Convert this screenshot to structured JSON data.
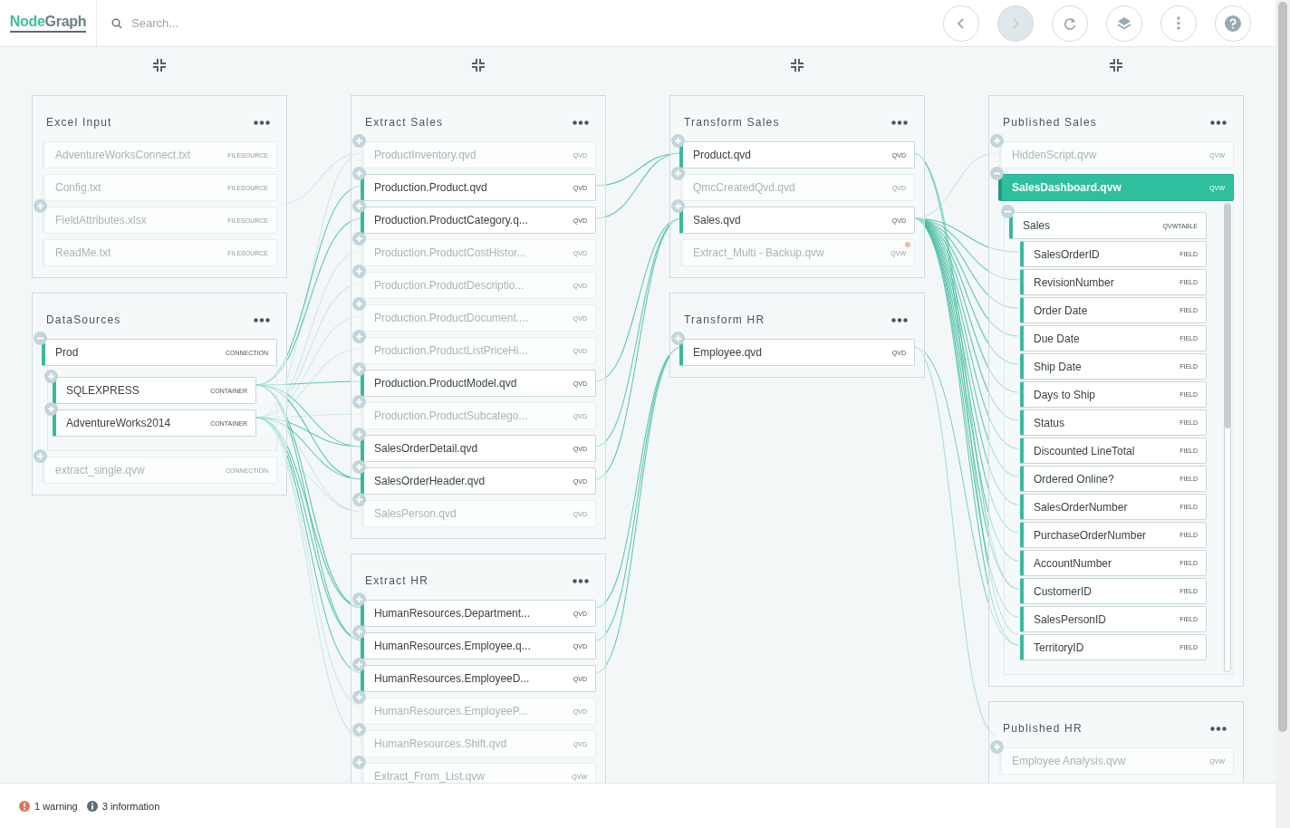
{
  "header": {
    "logo": [
      "Node",
      "Graph"
    ],
    "search": {
      "placeholder": "Search..."
    },
    "toolbar": [
      {
        "kind": "back",
        "disabled": false
      },
      {
        "kind": "forward",
        "disabled": true
      },
      {
        "kind": "refresh",
        "disabled": false
      },
      {
        "kind": "layers",
        "disabled": false
      },
      {
        "kind": "more",
        "disabled": false
      },
      {
        "kind": "help",
        "disabled": false
      }
    ]
  },
  "columns": [
    {
      "groups": [
        {
          "title": "Excel Input",
          "items": [
            {
              "label": "AdventureWorksConnect.txt",
              "type": "FILESOURCE",
              "active": false,
              "selected": false
            },
            {
              "label": "Config.txt",
              "type": "FILESOURCE",
              "active": false,
              "selected": false
            },
            {
              "label": "FieldAttributes.xlsx",
              "type": "FILESOURCE",
              "active": false,
              "selected": false,
              "expanded": false
            },
            {
              "label": "ReadMe.txt",
              "type": "FILESOURCE",
              "active": false,
              "selected": false
            }
          ]
        },
        {
          "title": "DataSources",
          "items": [
            {
              "label": "Prod",
              "type": "CONNECTION",
              "active": true,
              "selected": false,
              "expanded": true,
              "children": [
                {
                  "label": "SQLEXPRESS",
                  "type": "CONTAINER",
                  "active": true,
                  "selected": false,
                  "expanded": false
                },
                {
                  "label": "AdventureWorks2014",
                  "type": "CONTAINER",
                  "active": true,
                  "selected": false,
                  "expanded": false
                }
              ]
            },
            {
              "label": "extract_single.qvw",
              "type": "CONNECTION",
              "active": false,
              "selected": false,
              "expanded": false
            }
          ]
        }
      ]
    },
    {
      "groups": [
        {
          "title": "Extract Sales",
          "items": [
            {
              "label": "ProductInventory.qvd",
              "type": "QVD",
              "active": false,
              "selected": false,
              "expanded": false
            },
            {
              "label": "Production.Product.qvd",
              "type": "QVD",
              "active": true,
              "selected": false,
              "expanded": false
            },
            {
              "label": "Production.ProductCategory.q...",
              "type": "QVD",
              "active": true,
              "selected": false,
              "expanded": false
            },
            {
              "label": "Production.ProductCostHistor...",
              "type": "QVD",
              "active": false,
              "selected": false,
              "expanded": false
            },
            {
              "label": "Production.ProductDescriptio...",
              "type": "QVD",
              "active": false,
              "selected": false,
              "expanded": false
            },
            {
              "label": "Production.ProductDocument....",
              "type": "QVD",
              "active": false,
              "selected": false,
              "expanded": false
            },
            {
              "label": "Production.ProductListPriceHi...",
              "type": "QVD",
              "active": false,
              "selected": false,
              "expanded": false
            },
            {
              "label": "Production.ProductModel.qvd",
              "type": "QVD",
              "active": true,
              "selected": false,
              "expanded": false
            },
            {
              "label": "Production.ProductSubcatego...",
              "type": "QVD",
              "active": false,
              "selected": false,
              "expanded": false
            },
            {
              "label": "SalesOrderDetail.qvd",
              "type": "QVD",
              "active": true,
              "selected": false,
              "expanded": false
            },
            {
              "label": "SalesOrderHeader.qvd",
              "type": "QVD",
              "active": true,
              "selected": false,
              "expanded": false
            },
            {
              "label": "SalesPerson.qvd",
              "type": "QVD",
              "active": false,
              "selected": false,
              "expanded": false
            }
          ]
        },
        {
          "title": "Extract HR",
          "items": [
            {
              "label": "HumanResources.Department...",
              "type": "QVD",
              "active": true,
              "selected": false,
              "expanded": false
            },
            {
              "label": "HumanResources.Employee.q...",
              "type": "QVD",
              "active": true,
              "selected": false,
              "expanded": false
            },
            {
              "label": "HumanResources.EmployeeD...",
              "type": "QVD",
              "active": true,
              "selected": false,
              "expanded": false
            },
            {
              "label": "HumanResources.EmployeeP...",
              "type": "QVD",
              "active": false,
              "selected": false,
              "expanded": false
            },
            {
              "label": "HumanResources.Shift.qvd",
              "type": "QVD",
              "active": false,
              "selected": false,
              "expanded": false
            },
            {
              "label": "Extract_From_List.qvw",
              "type": "QVW",
              "active": false,
              "selected": false,
              "expanded": false
            }
          ]
        }
      ]
    },
    {
      "groups": [
        {
          "title": "Transform Sales",
          "items": [
            {
              "label": "Product.qvd",
              "type": "QVD",
              "active": true,
              "selected": false,
              "warning": false,
              "expanded": false
            },
            {
              "label": "QmcCreatedQvd.qvd",
              "type": "QVD",
              "active": false,
              "selected": false,
              "warning": false,
              "expanded": false
            },
            {
              "label": "Sales.qvd",
              "type": "QVD",
              "active": true,
              "selected": false,
              "warning": false,
              "expanded": false
            },
            {
              "label": "Extract_Multi - Backup.qvw",
              "type": "QVW",
              "active": false,
              "selected": false,
              "warning": true
            }
          ]
        },
        {
          "title": "Transform HR",
          "items": [
            {
              "label": "Employee.qvd",
              "type": "QVD",
              "active": true,
              "selected": false,
              "expanded": false
            }
          ]
        }
      ]
    },
    {
      "groups": [
        {
          "title": "Published Sales",
          "items": [
            {
              "label": "HiddenScript.qvw",
              "type": "QVW",
              "active": false,
              "selected": false,
              "expanded": false
            },
            {
              "label": "SalesDashboard.qvw",
              "type": "QVW",
              "active": true,
              "selected": true,
              "expanded": true,
              "children": [
                {
                  "label": "Sales",
                  "type": "QVWTABLE",
                  "active": true,
                  "selected": false,
                  "expanded": true,
                  "children": [
                    {
                      "label": "SalesOrderID",
                      "type": "FIELD",
                      "active": true,
                      "selected": false
                    },
                    {
                      "label": "RevisionNumber",
                      "type": "FIELD",
                      "active": true,
                      "selected": false
                    },
                    {
                      "label": "Order Date",
                      "type": "FIELD",
                      "active": true,
                      "selected": false
                    },
                    {
                      "label": "Due Date",
                      "type": "FIELD",
                      "active": true,
                      "selected": false
                    },
                    {
                      "label": "Ship Date",
                      "type": "FIELD",
                      "active": true,
                      "selected": false
                    },
                    {
                      "label": "Days to Ship",
                      "type": "FIELD",
                      "active": true,
                      "selected": false
                    },
                    {
                      "label": "Status",
                      "type": "FIELD",
                      "active": true,
                      "selected": false
                    },
                    {
                      "label": "Discounted LineTotal",
                      "type": "FIELD",
                      "active": true,
                      "selected": false
                    },
                    {
                      "label": "Ordered Online?",
                      "type": "FIELD",
                      "active": true,
                      "selected": false
                    },
                    {
                      "label": "SalesOrderNumber",
                      "type": "FIELD",
                      "active": true,
                      "selected": false
                    },
                    {
                      "label": "PurchaseOrderNumber",
                      "type": "FIELD",
                      "active": true,
                      "selected": false
                    },
                    {
                      "label": "AccountNumber",
                      "type": "FIELD",
                      "active": true,
                      "selected": false
                    },
                    {
                      "label": "CustomerID",
                      "type": "FIELD",
                      "active": true,
                      "selected": false
                    },
                    {
                      "label": "SalesPersonID",
                      "type": "FIELD",
                      "active": true,
                      "selected": false
                    },
                    {
                      "label": "TerritoryID",
                      "type": "FIELD",
                      "active": true,
                      "selected": false
                    }
                  ]
                }
              ]
            }
          ]
        },
        {
          "title": "Published HR",
          "items": [
            {
              "label": "Employee Analysis.qvw",
              "type": "QVW",
              "active": false,
              "selected": false,
              "expanded": false
            }
          ]
        }
      ]
    }
  ],
  "status_bar": [
    {
      "kind": "warning",
      "text": "1 warning"
    },
    {
      "kind": "info",
      "text": "3 information"
    }
  ]
}
